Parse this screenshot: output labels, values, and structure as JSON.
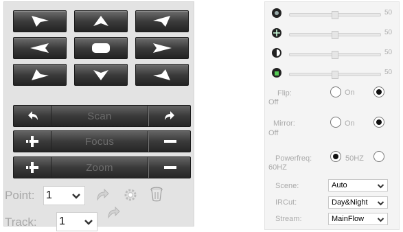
{
  "ptz": {
    "directions": [
      "up-left",
      "up",
      "up-right",
      "left",
      "center",
      "right",
      "down-left",
      "down",
      "down-right"
    ],
    "scan_label": "Scan",
    "focus_label": "Focus",
    "zoom_label": "Zoom",
    "point_label": "Point:",
    "point_value": "1",
    "track_label": "Track:",
    "track_value": "1"
  },
  "image": {
    "sliders": [
      {
        "icon": "brightness-icon",
        "value": "50"
      },
      {
        "icon": "saturation-icon",
        "value": "50"
      },
      {
        "icon": "contrast-icon",
        "value": "50"
      },
      {
        "icon": "sharpness-icon",
        "value": "50"
      }
    ],
    "flip": {
      "label": "Flip:",
      "on_label": "On",
      "off_label": "Off",
      "selected": "off"
    },
    "mirror": {
      "label": "Mirror:",
      "on_label": "On",
      "off_label": "Off",
      "selected": "off"
    },
    "powerfreq": {
      "label": "Powerfreq:",
      "opt1_label": "50HZ",
      "opt2_label": "60HZ",
      "selected": "50HZ"
    },
    "scene": {
      "label": "Scene:",
      "value": "Auto"
    },
    "ircut": {
      "label": "IRCut:",
      "value": "Day&Night"
    },
    "stream": {
      "label": "Stream:",
      "value": "MainFlow"
    }
  }
}
